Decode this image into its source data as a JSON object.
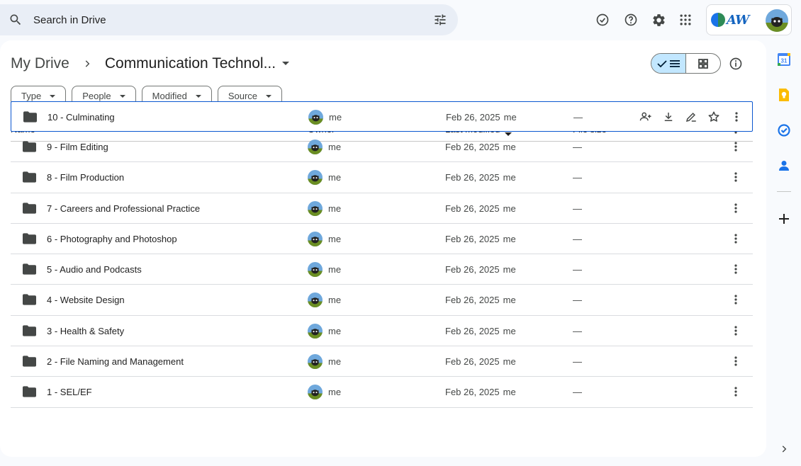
{
  "search": {
    "placeholder": "Search in Drive"
  },
  "breadcrumb": {
    "root": "My Drive",
    "current": "Communication Technol..."
  },
  "filters": [
    "Type",
    "People",
    "Modified",
    "Source"
  ],
  "table": {
    "headers": {
      "name": "Name",
      "owner": "Owner",
      "modified": "Last modified",
      "size": "File size"
    },
    "rows": [
      {
        "name": "10 - Culminating",
        "owner": "me",
        "modified": "Feb 26, 2025",
        "by": "me",
        "size": "—"
      },
      {
        "name": "9 - Film Editing",
        "owner": "me",
        "modified": "Feb 26, 2025",
        "by": "me",
        "size": "—"
      },
      {
        "name": "8 - Film Production",
        "owner": "me",
        "modified": "Feb 26, 2025",
        "by": "me",
        "size": "—"
      },
      {
        "name": "7 - Careers and Professional Practice",
        "owner": "me",
        "modified": "Feb 26, 2025",
        "by": "me",
        "size": "—"
      },
      {
        "name": "6 - Photography and Photoshop",
        "owner": "me",
        "modified": "Feb 26, 2025",
        "by": "me",
        "size": "—"
      },
      {
        "name": "5 - Audio and Podcasts",
        "owner": "me",
        "modified": "Feb 26, 2025",
        "by": "me",
        "size": "—"
      },
      {
        "name": "4 - Website Design",
        "owner": "me",
        "modified": "Feb 26, 2025",
        "by": "me",
        "size": "—"
      },
      {
        "name": "3 - Health & Safety",
        "owner": "me",
        "modified": "Feb 26, 2025",
        "by": "me",
        "size": "—"
      },
      {
        "name": "2 - File Naming and Management",
        "owner": "me",
        "modified": "Feb 26, 2025",
        "by": "me",
        "size": "—"
      },
      {
        "name": "1 - SEL/EF",
        "owner": "me",
        "modified": "Feb 26, 2025",
        "by": "me",
        "size": "—"
      }
    ]
  },
  "account": {
    "logo_text": "AW"
  },
  "side_panel": {
    "calendar_day": "31"
  },
  "colors": {
    "accent": "#0b57d0",
    "toggle_active": "#c2e7ff",
    "search_bg": "#e9eef6"
  }
}
